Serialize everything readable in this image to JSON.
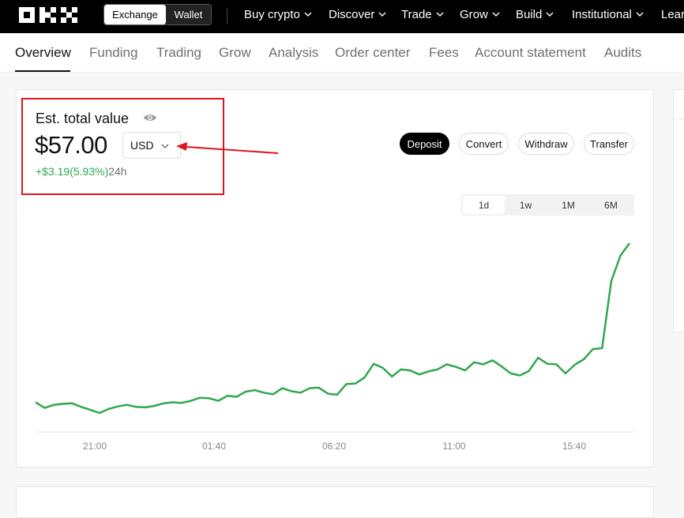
{
  "topnav": {
    "logo": "OKX",
    "segment": {
      "exchange": "Exchange",
      "wallet": "Wallet"
    },
    "items": [
      "Buy crypto",
      "Discover",
      "Trade",
      "Grow",
      "Build",
      "Institutional",
      "Lear"
    ]
  },
  "tabs": [
    "Overview",
    "Funding",
    "Trading",
    "Grow",
    "Analysis",
    "Order center",
    "Fees",
    "Account statement",
    "Audits"
  ],
  "summary": {
    "label": "Est. total value",
    "total": "$57.00",
    "currency": "USD",
    "change": "+$3.19(5.93%)",
    "change_period": "24h"
  },
  "actions": [
    "Deposit",
    "Convert",
    "Withdraw",
    "Transfer"
  ],
  "ranges": [
    "1d",
    "1w",
    "1M",
    "6M"
  ],
  "active_range": "1d",
  "colors": {
    "line": "#2fa84f",
    "highlight": "#e0141e"
  },
  "chart_data": {
    "type": "line",
    "x_ticks": [
      "21:00",
      "01:40",
      "06:20",
      "11:00",
      "15:40"
    ],
    "ylabel": "",
    "xlabel": "",
    "values": [
      53.81,
      53.7,
      53.76,
      53.78,
      53.79,
      53.72,
      53.66,
      53.6,
      53.68,
      53.73,
      53.76,
      53.72,
      53.71,
      53.74,
      53.79,
      53.81,
      53.8,
      53.84,
      53.9,
      53.89,
      53.84,
      53.94,
      53.92,
      54.02,
      54.05,
      54.0,
      53.97,
      54.09,
      54.03,
      54.0,
      54.09,
      54.1,
      53.98,
      53.96,
      54.17,
      54.18,
      54.3,
      54.57,
      54.49,
      54.32,
      54.46,
      54.44,
      54.36,
      54.42,
      54.46,
      54.56,
      54.51,
      54.44,
      54.6,
      54.56,
      54.64,
      54.52,
      54.38,
      54.34,
      54.43,
      54.69,
      54.57,
      54.56,
      54.38,
      54.55,
      54.66,
      54.86,
      54.88,
      56.2,
      56.7,
      56.95
    ],
    "grid": false
  }
}
